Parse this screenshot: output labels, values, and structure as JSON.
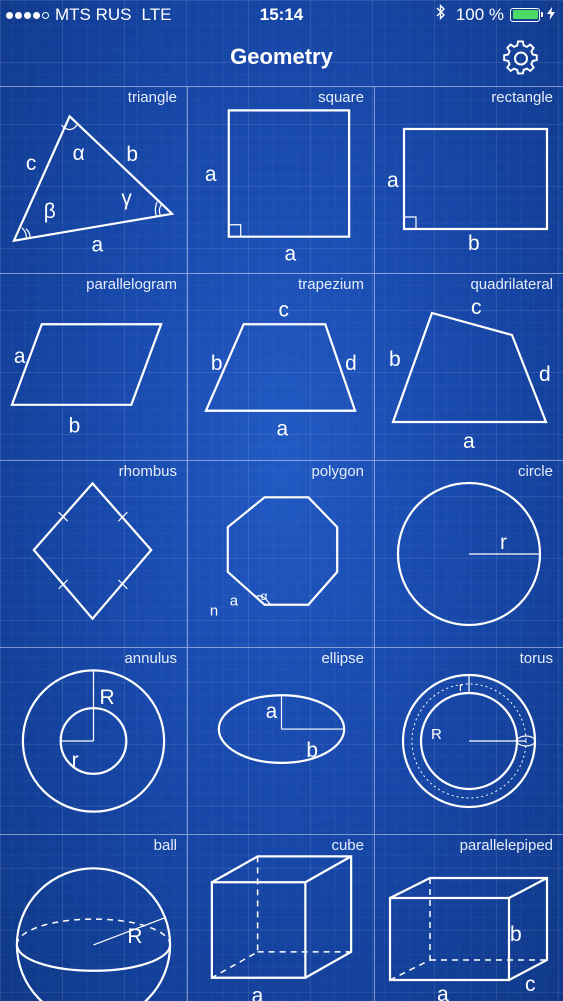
{
  "status_bar": {
    "carrier": "MTS RUS",
    "network": "LTE",
    "time": "15:14",
    "battery": "100 %",
    "battery_level": 1.0,
    "signal_bars": 4
  },
  "nav": {
    "title": "Geometry",
    "settings_icon": "gear-icon"
  },
  "colors": {
    "background": "#1646a6",
    "battery_green": "#4cd964",
    "line": "#ffffff"
  },
  "shapes": {
    "triangle": {
      "label": "triangle",
      "a": "a",
      "b": "b",
      "c": "c",
      "alpha": "α",
      "beta": "β",
      "gamma": "γ"
    },
    "square": {
      "label": "square",
      "a1": "a",
      "a2": "a"
    },
    "rectangle": {
      "label": "rectangle",
      "a": "a",
      "b": "b"
    },
    "parallelogram": {
      "label": "parallelogram",
      "a": "a",
      "b": "b"
    },
    "trapezium": {
      "label": "trapezium",
      "a": "a",
      "b": "b",
      "c": "c",
      "d": "d"
    },
    "quadrilateral": {
      "label": "quadrilateral",
      "a": "a",
      "b": "b",
      "c": "c",
      "d": "d"
    },
    "rhombus": {
      "label": "rhombus"
    },
    "polygon": {
      "label": "polygon",
      "n": "n",
      "a": "a",
      "alpha": "α"
    },
    "circle": {
      "label": "circle",
      "r": "r"
    },
    "annulus": {
      "label": "annulus",
      "R": "R",
      "r": "r"
    },
    "ellipse": {
      "label": "ellipse",
      "a": "a",
      "b": "b"
    },
    "torus": {
      "label": "torus",
      "R": "R",
      "r": "r"
    },
    "ball": {
      "label": "ball",
      "R": "R"
    },
    "cube": {
      "label": "cube",
      "a": "a"
    },
    "parallelepiped": {
      "label": "parallelepiped",
      "a": "a",
      "b": "b",
      "c": "c"
    }
  }
}
